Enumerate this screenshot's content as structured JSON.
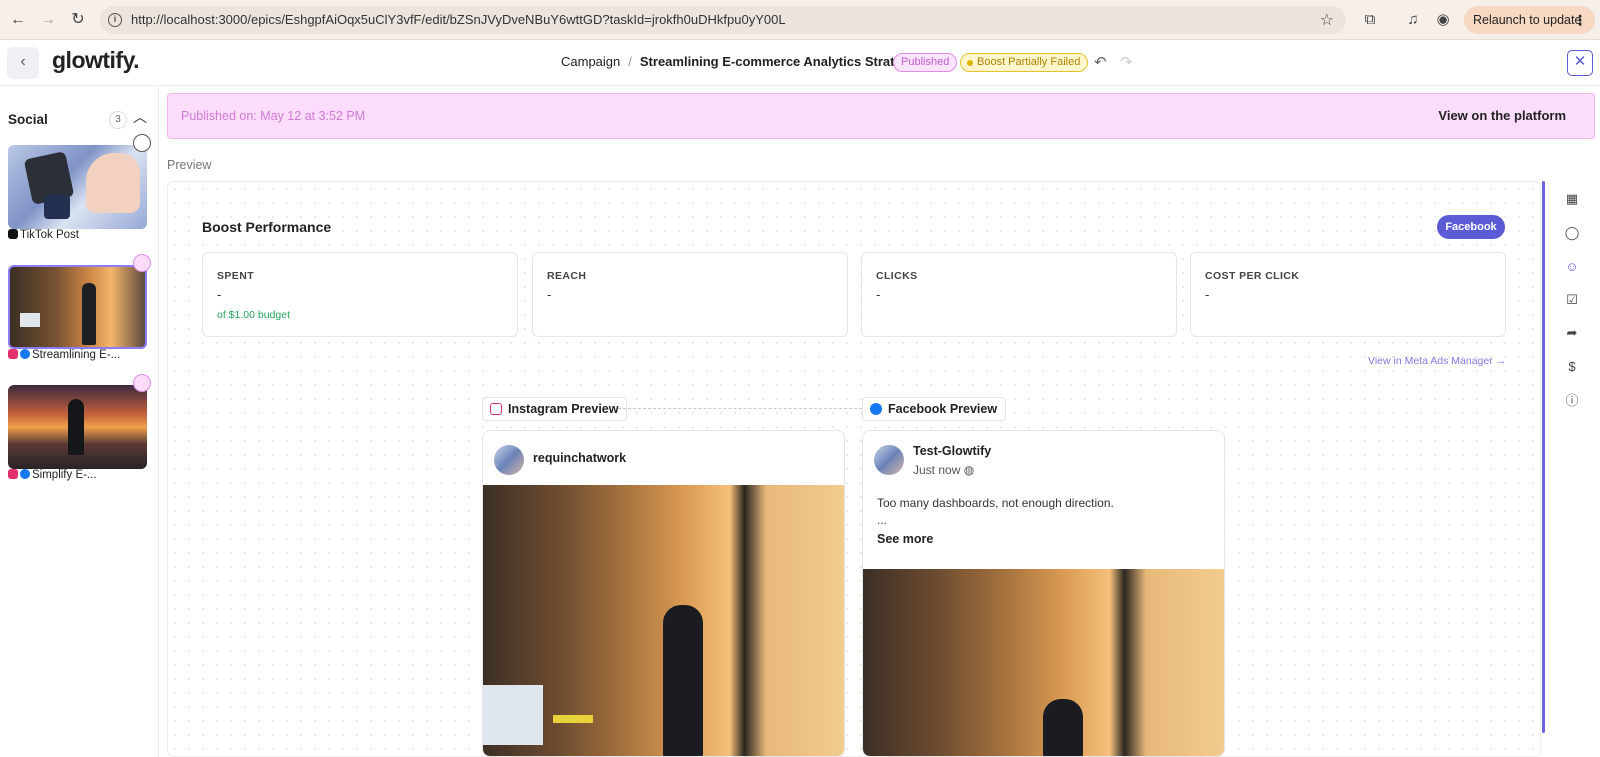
{
  "browser": {
    "url": "http://localhost:3000/epics/EshgpfAiOqx5uClY3vfF/edit/bZSnJVyDveNBuY6wttGD?taskId=jrokfh0uDHkfpu0yY00L",
    "relaunch_label": "Relaunch to update"
  },
  "header": {
    "logo": "glowtify.",
    "breadcrumb_root": "Campaign",
    "breadcrumb_sep": "/",
    "breadcrumb_title": "Streamlining E-commerce Analytics Strate...",
    "status_published": "Published",
    "status_boost": "Boost Partially Failed"
  },
  "sidebar": {
    "title": "Social",
    "count": "3",
    "items": [
      {
        "label": "TikTok Post",
        "icon": "tiktok-icon"
      },
      {
        "label": "Streamlining E-...",
        "icon": "instagram-facebook-icons",
        "selected": true
      },
      {
        "label": "Simplify E-...",
        "icon": "instagram-facebook-icons"
      }
    ]
  },
  "banner": {
    "text": "Published on: May 12 at 3:52 PM",
    "link": "View on the platform"
  },
  "preview": {
    "label": "Preview",
    "boost_title": "Boost Performance",
    "platform_pill": "Facebook",
    "metrics": [
      {
        "label": "SPENT",
        "value": "-",
        "sub": "of $1.00 budget"
      },
      {
        "label": "REACH",
        "value": "-"
      },
      {
        "label": "CLICKS",
        "value": "-"
      },
      {
        "label": "COST PER CLICK",
        "value": "-"
      }
    ],
    "meta_link": "View in Meta Ads Manager →",
    "instagram_chip": "Instagram Preview",
    "facebook_chip": "Facebook Preview",
    "instagram": {
      "username": "requinchatwork"
    },
    "facebook": {
      "page_name": "Test-Glowtify",
      "time": "Just now",
      "text": "Too many dashboards, not enough direction.",
      "ellipsis": "...",
      "see_more": "See more"
    }
  },
  "colors": {
    "accent": "#5b5bd6",
    "published_bg": "#fbe4fd",
    "boost_warning": "#e1b400",
    "spent_sub": "#25a45a"
  }
}
